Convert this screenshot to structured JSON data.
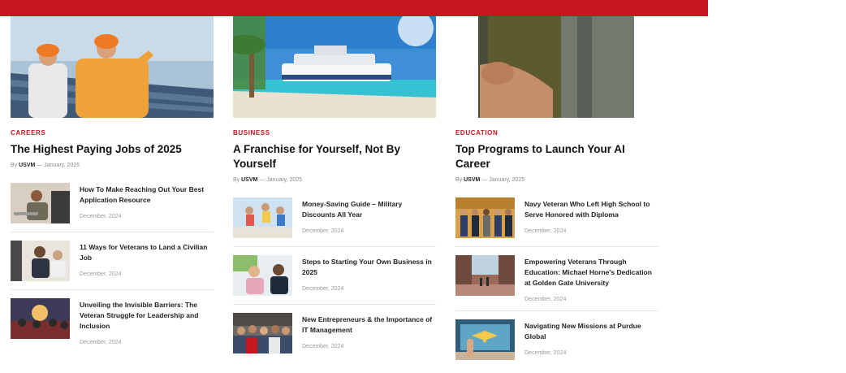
{
  "columns": [
    {
      "category": "CAREERS",
      "headline": "The Highest Paying Jobs of 2025",
      "byline": {
        "prefix": "By",
        "author": "USVM",
        "separator": "—",
        "date": "January, 2025"
      },
      "items": [
        {
          "title": "How To Make Reaching Out Your Best Application Resource",
          "date": "December, 2024"
        },
        {
          "title": "11 Ways for Veterans to Land a Civilian Job",
          "date": "December, 2024"
        },
        {
          "title": "Unveiling the Invisible Barriers: The Veteran Struggle for Leadership and Inclusion",
          "date": "December, 2024"
        }
      ]
    },
    {
      "category": "BUSINESS",
      "headline": "A Franchise for Yourself, Not By Yourself",
      "byline": {
        "prefix": "By",
        "author": "USVM",
        "separator": "—",
        "date": "January, 2025"
      },
      "items": [
        {
          "title": "Money-Saving Guide – Military Discounts All Year",
          "date": "December, 2024"
        },
        {
          "title": "Steps to Starting Your Own Business in 2025",
          "date": "December, 2024"
        },
        {
          "title": "New Entrepreneurs & the Importance of IT Management",
          "date": "December, 2024"
        }
      ]
    },
    {
      "category": "EDUCATION",
      "headline": "Top Programs to Launch Your AI Career",
      "byline": {
        "prefix": "By",
        "author": "USVM",
        "separator": "—",
        "date": "January, 2025"
      },
      "items": [
        {
          "title": "Navy Veteran Who Left High School to Serve Honored with Diploma",
          "date": "December, 2024"
        },
        {
          "title": "Empowering Veterans Through Education: Michael Horne's Dedication at Golden Gate University",
          "date": "December, 2024"
        },
        {
          "title": "Navigating New Missions at Purdue Global",
          "date": "December, 2024"
        }
      ]
    }
  ],
  "colors": {
    "brand_red": "#c8161e",
    "text": "#111111",
    "meta": "#8a8a8a"
  }
}
